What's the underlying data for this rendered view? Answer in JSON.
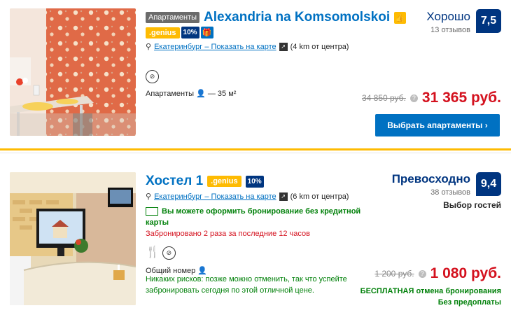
{
  "listings": [
    {
      "type_chip": "Апартаменты",
      "name": "Alexandria na Komsomolskoi",
      "genius": ".genius",
      "discount": "10%",
      "location": "Екатеринбург – Показать на карте",
      "distance": "(4 km от центра)",
      "room_type": "Апартаменты",
      "room_size": "— 35 м²",
      "score_word": "Хорошо",
      "reviews": "13 отзывов",
      "score": "7,5",
      "old_price": "34 850 руб.",
      "new_price": "31 365 руб.",
      "button": "Выбрать апартаменты  ›",
      "icons": [
        "thumbs-up-icon",
        "gift-icon",
        "map-pin-icon",
        "distance-icon",
        "no-smoking-icon",
        "person-icon",
        "info-icon"
      ]
    },
    {
      "name": "Хостел 1",
      "genius": ".genius",
      "discount": "10%",
      "location": "Екатеринбург – Показать на карте",
      "distance": "(6 km от центра)",
      "no_card": "Вы можете оформить бронирование без кредитной карты",
      "booked": "Забронировано 2 раза за последние 12 часов",
      "room_type": "Общий номер",
      "no_risk": "Никаких рисков: позже можно отменить, так что успейте забронировать сегодня по этой отличной цене.",
      "score_word": "Превосходно",
      "reviews": "38 отзывов",
      "score": "9,4",
      "guest_choice": "Выбор гостей",
      "old_price": "1 200 руб.",
      "new_price": "1 080 руб.",
      "free_cancel": "БЕСПЛАТНАЯ отмена бронирования",
      "no_prepay": "Без предоплаты",
      "icons": [
        "credit-card-icon",
        "fork-knife-icon",
        "no-smoking-icon",
        "person-icon",
        "info-icon",
        "map-pin-icon",
        "distance-icon"
      ]
    }
  ],
  "colors": {
    "brand_blue": "#0071c2",
    "score_navy": "#003580",
    "genius_yellow": "#febb02",
    "price_red": "#d4111e",
    "green": "#008009"
  }
}
